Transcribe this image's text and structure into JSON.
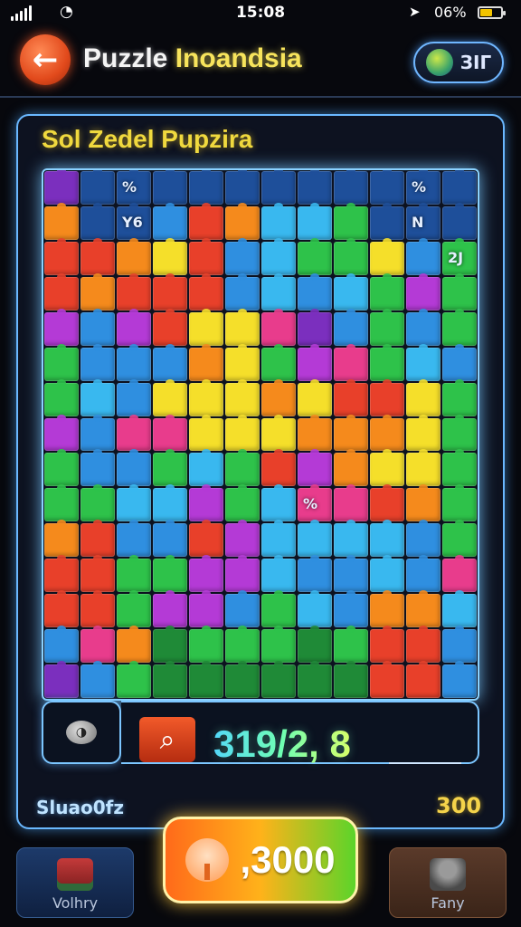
{
  "status_bar": {
    "time": "15:08",
    "battery_pct": "06%",
    "battery_level": 0.6
  },
  "header": {
    "back_icon": "back-arrow-icon",
    "title_part1": "Puzzle",
    "title_part2": "Inoandsia",
    "coins_label": "ЗIГ"
  },
  "board": {
    "title": "Sol Zedel Pupzira",
    "cols": 12,
    "rows": 15,
    "palette": {
      "P": "#7b2fbe",
      "N": "#1e4f9a",
      "B": "#2f8fe0",
      "C": "#39b8ef",
      "G": "#2ec24a",
      "D": "#1f8a37",
      "L": "#8ee03a",
      "Y": "#f5df2a",
      "O": "#f58a1c",
      "R": "#e8402a",
      "K": "#e83c8c",
      "M": "#b43ad6"
    },
    "tiles": [
      "PNNNNNNNNNNN",
      "ONNBROCCGNNN",
      "RROYRBCGGYBG",
      "RORRRBCBCGMG",
      "MBMRYYKPBGBG",
      "GBBBOYGMKGCB",
      "GCBYYYOYRRYG",
      "MBKKYYYOOOYG",
      "GBBGCGRMOYYG",
      "GGCCMGCKKROG",
      "ORBBRMCCCCBG",
      "RRGGMMCBBCBK",
      "RRGMMBGCBOOC",
      "BKODGGGDGRRB",
      "PBGDDDDDDRRB"
    ],
    "marks": [
      {
        "text": "%",
        "row": 0,
        "col": 2
      },
      {
        "text": "%",
        "row": 0,
        "col": 10
      },
      {
        "text": "Y6",
        "row": 1,
        "col": 2
      },
      {
        "text": "N",
        "row": 1,
        "col": 10
      },
      {
        "text": "2J",
        "row": 2,
        "col": 11
      },
      {
        "text": "%",
        "row": 9,
        "col": 7
      }
    ]
  },
  "info_row": {
    "hint_icon": "hint-orb-icon",
    "timer_icon": "timer-icon",
    "score": "319/2, 8",
    "left_label": "Sluao0fz",
    "right_value": "300"
  },
  "bottom_bar": {
    "left_button": {
      "label": "Volhry",
      "icon": "gift-icon"
    },
    "play_button": {
      "value": ",3000",
      "icon": "tree-icon"
    },
    "right_button": {
      "label": "Fany",
      "icon": "person-icon"
    }
  }
}
